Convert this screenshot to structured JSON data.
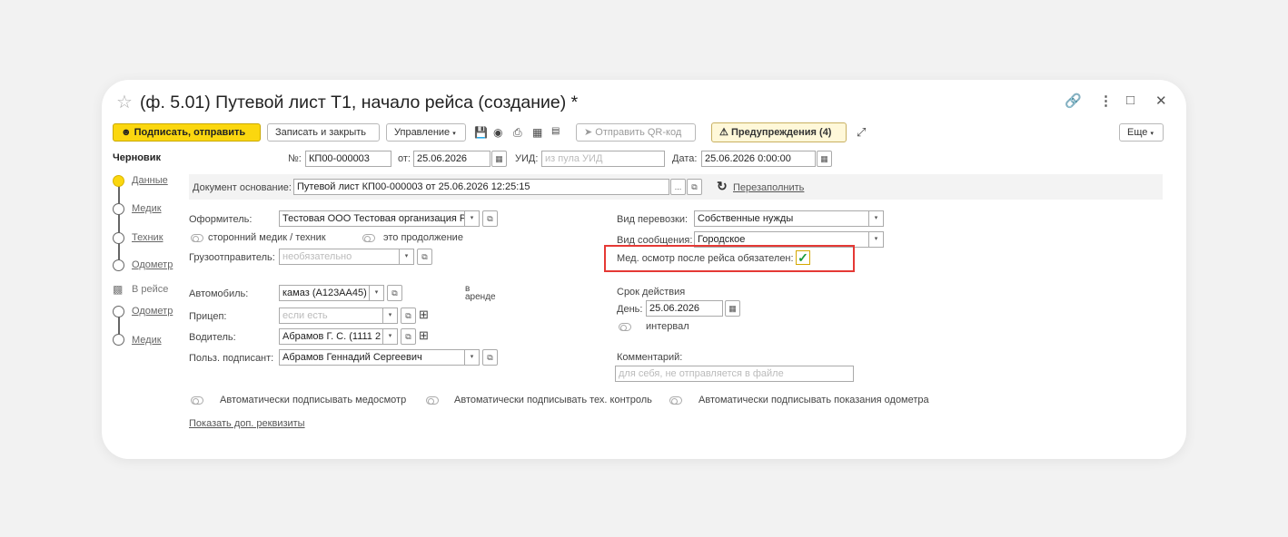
{
  "window": {
    "title": "(ф. 5.01) Путевой лист Т1, начало рейса (создание) *",
    "star": "☆",
    "link_icon": "🔗",
    "more_icon": "⋮",
    "max_icon": "□",
    "close_icon": "✕"
  },
  "toolbar": {
    "sign_send": "Подписать, отправить",
    "save_close": "Записать и закрыть",
    "manage": "Управление",
    "send_qr": "Отправить QR-код",
    "warnings": "Предупреждения (4)",
    "more": "Еще"
  },
  "status": "Черновик",
  "nav": [
    {
      "label": "Данные"
    },
    {
      "label": "Медик"
    },
    {
      "label": "Техник"
    },
    {
      "label": "Одометр"
    },
    {
      "label": "В рейсе"
    },
    {
      "label": "Одометр"
    },
    {
      "label": "Медик"
    }
  ],
  "header": {
    "num_label": "№:",
    "num_value": "КП00-000003",
    "from_label": "от:",
    "from_value": "25.06.2026",
    "uid_label": "УИД:",
    "uid_placeholder": "из пула УИД",
    "date_label": "Дата:",
    "date_value": "25.06.2026  0:00:00"
  },
  "base_doc": {
    "label": "Документ основание:",
    "value": "Путевой лист КП00-000003 от 25.06.2026 12:25:15",
    "refill": "Перезаполнить"
  },
  "left": {
    "issuer_label": "Оформитель:",
    "issuer_value": "Тестовая ООО Тестовая организация Р",
    "third_party": "сторонний медик / техник",
    "continuation": "это продолжение",
    "shipper_label": "Грузоотправитель:",
    "shipper_placeholder": "необязательно",
    "car_label": "Автомобиль:",
    "car_value": "камаз (А123АА45)",
    "rent_label": "в\nаренде",
    "trailer_label": "Прицеп:",
    "trailer_placeholder": "если есть",
    "driver_label": "Водитель:",
    "driver_value": "Абрамов Г. С. (1111 2",
    "signer_label": "Польз. подписант:",
    "signer_value": "Абрамов Геннадий Сергеевич"
  },
  "right": {
    "transport_label": "Вид перевозки:",
    "transport_value": "Собственные нужды",
    "message_label": "Вид сообщения:",
    "message_value": "Городское",
    "medcheck_label": "Мед. осмотр после рейса обязателен:",
    "validity_label": "Срок действия",
    "day_label": "День:",
    "day_value": "25.06.2026",
    "interval_label": "интервал",
    "comment_label": "Комментарий:",
    "comment_placeholder": "для себя, не отправляется в файле"
  },
  "bottom": {
    "auto_med": "Автоматически подписывать медосмотр",
    "auto_tech": "Автоматически подписывать тех. контроль",
    "auto_odo": "Автоматически подписывать показания одометра",
    "show_more": "Показать доп. реквизиты"
  },
  "colors": {
    "accent": "#fbd70f",
    "highlight": "#e53935",
    "check": "#1a9c3c"
  }
}
